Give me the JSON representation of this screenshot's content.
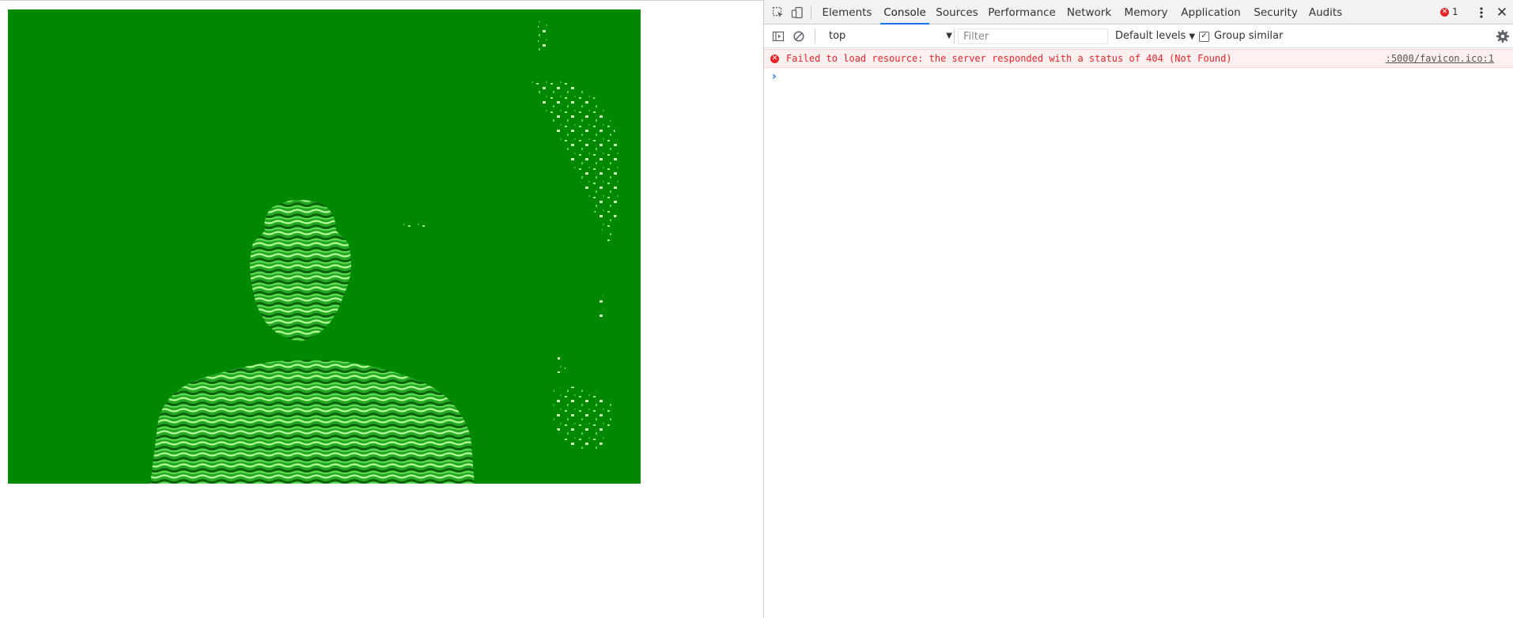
{
  "devtools": {
    "tabs": [
      {
        "label": "Elements"
      },
      {
        "label": "Console"
      },
      {
        "label": "Sources"
      },
      {
        "label": "Performance"
      },
      {
        "label": "Network"
      },
      {
        "label": "Memory"
      },
      {
        "label": "Application"
      },
      {
        "label": "Security"
      },
      {
        "label": "Audits"
      }
    ],
    "active_tab": "Console",
    "error_count": "1",
    "accent_color": "#1a73e8",
    "error_color": "#e5252a"
  },
  "console": {
    "context": "top",
    "filter_placeholder": "Filter",
    "levels_label": "Default levels",
    "group_similar_label": "Group similar",
    "group_similar_checked": true,
    "messages": [
      {
        "level": "error",
        "text": "Failed to load resource: the server responded with a status of 404 (Not Found)",
        "source": ":5000/favicon.ico:1"
      }
    ],
    "prompt_symbol": "›"
  },
  "page": {
    "depth_frame_bg": "#008800"
  }
}
